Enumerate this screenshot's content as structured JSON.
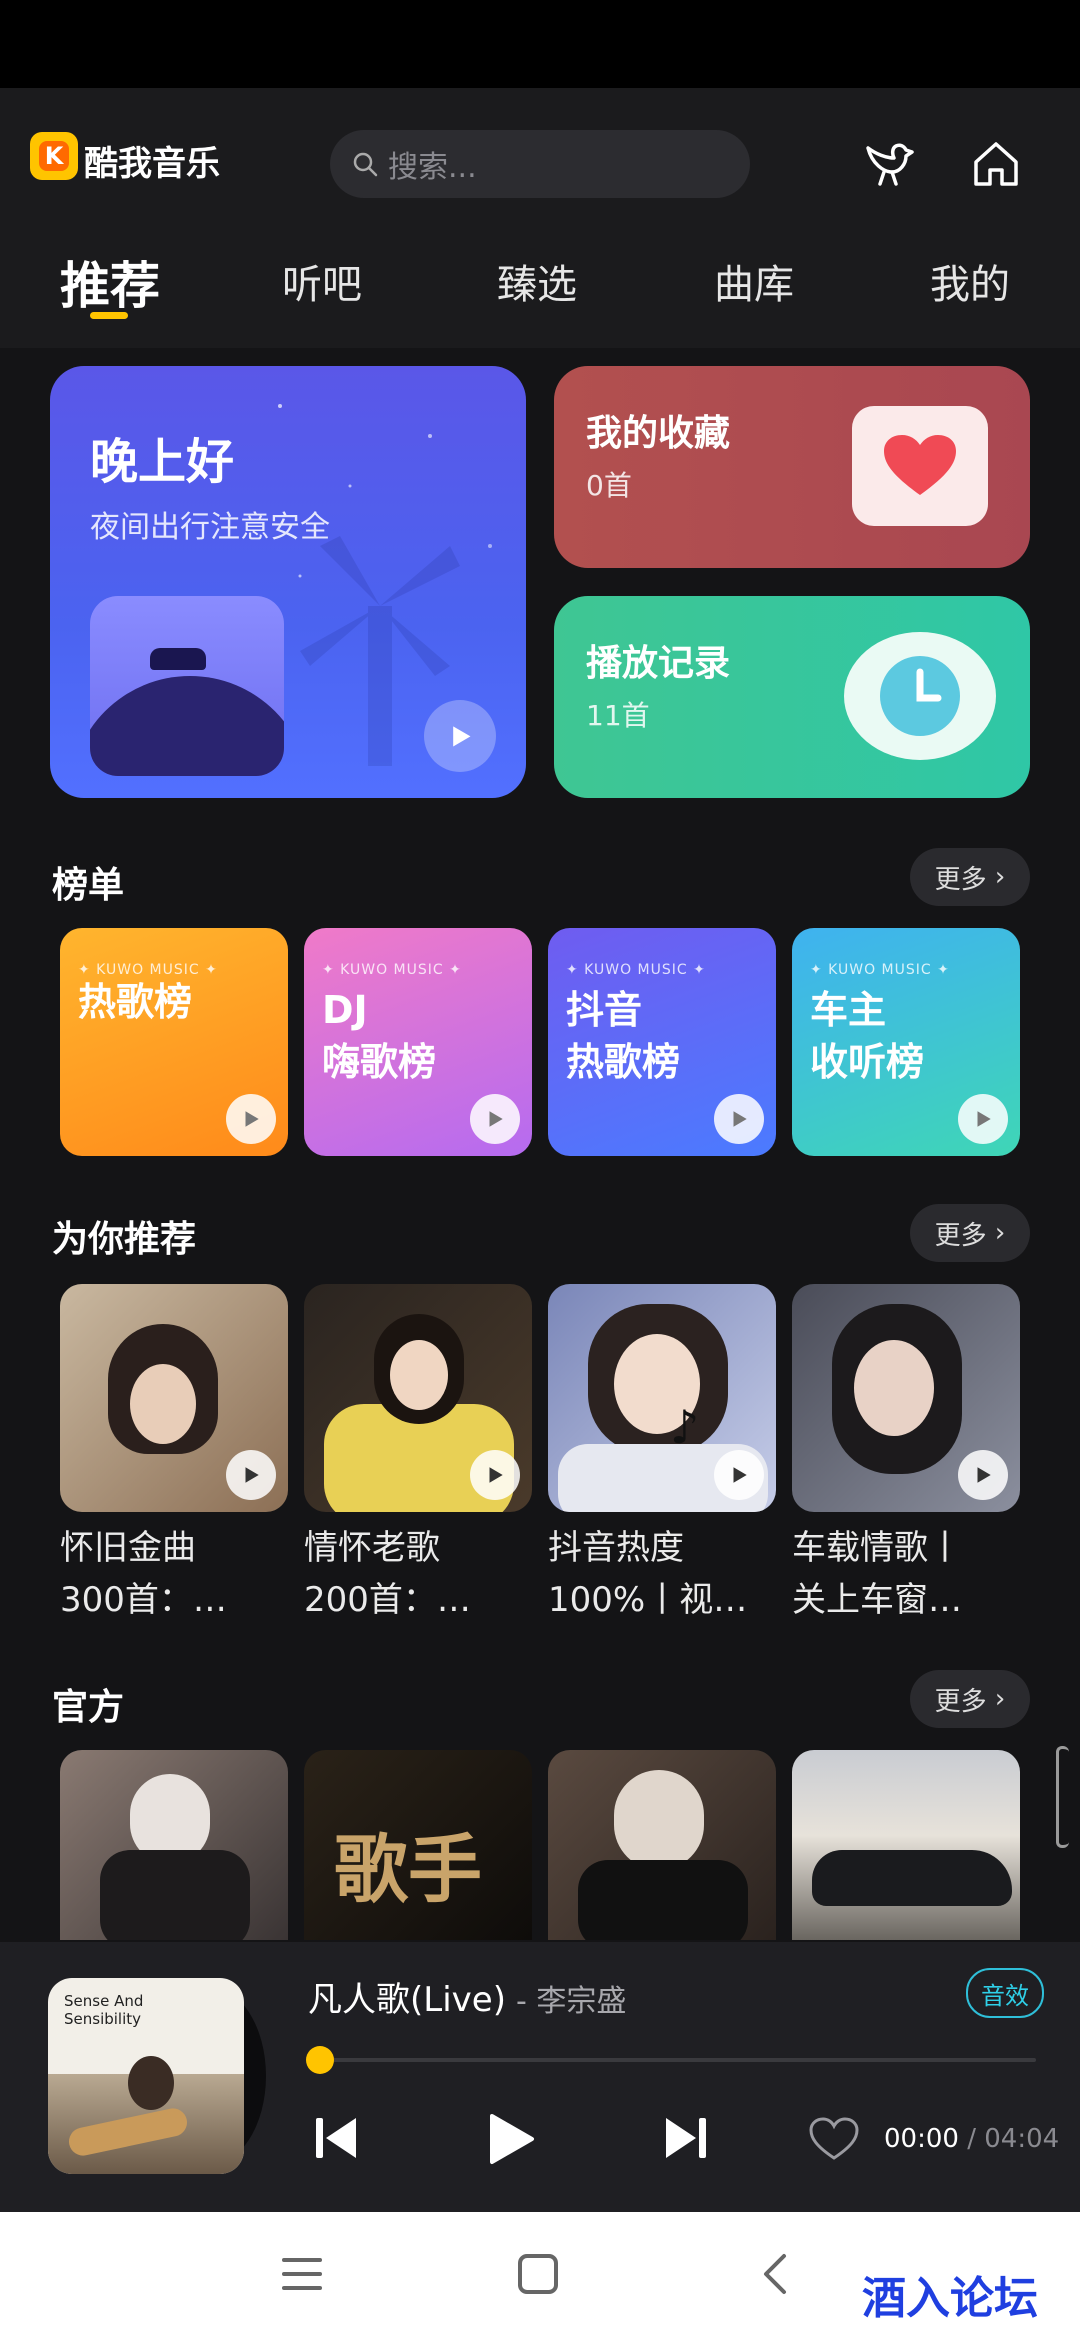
{
  "app": {
    "name": "酷我音乐"
  },
  "search": {
    "placeholder": "搜索..."
  },
  "tabs": [
    {
      "label": "推荐",
      "active": true
    },
    {
      "label": "听吧"
    },
    {
      "label": "臻选"
    },
    {
      "label": "曲库"
    },
    {
      "label": "我的"
    }
  ],
  "cards": {
    "evening": {
      "title": "晚上好",
      "subtitle": "夜间出行注意安全"
    },
    "favorites": {
      "title": "我的收藏",
      "count": "0首"
    },
    "history": {
      "title": "播放记录",
      "count": "11首"
    }
  },
  "sections": {
    "charts": {
      "title": "榜单",
      "more": "更多"
    },
    "recommend": {
      "title": "为你推荐",
      "more": "更多"
    },
    "official": {
      "title": "官方",
      "more": "更多"
    }
  },
  "charts": [
    {
      "brand": "✦ KUWO MUSIC ✦",
      "line1": "热歌榜",
      "line2": ""
    },
    {
      "brand": "✦ KUWO MUSIC ✦",
      "line1": "DJ",
      "line2": "嗨歌榜"
    },
    {
      "brand": "✦ KUWO MUSIC ✦",
      "line1": "抖音",
      "line2": "热歌榜"
    },
    {
      "brand": "✦ KUWO MUSIC ✦",
      "line1": "车主",
      "line2": "收听榜"
    }
  ],
  "recommend": [
    {
      "line1": "怀旧金曲",
      "line2": "300首：…"
    },
    {
      "line1": "情怀老歌",
      "line2": "200首：…"
    },
    {
      "line1": "抖音热度",
      "line2": "100%丨视…"
    },
    {
      "line1": "车载情歌丨",
      "line2": "关上车窗…"
    }
  ],
  "player": {
    "song": "凡人歌(Live)",
    "artist": "- 李宗盛",
    "effect": "音效",
    "current": "00:00",
    "sep": " / ",
    "total": "04:04",
    "album_text": "Sense And Sensibility",
    "progress": 0.0
  },
  "watermark": "酒入论坛",
  "colors": {
    "accent": "#ffc400",
    "background": "#141416",
    "effect": "#2fd0e8"
  }
}
